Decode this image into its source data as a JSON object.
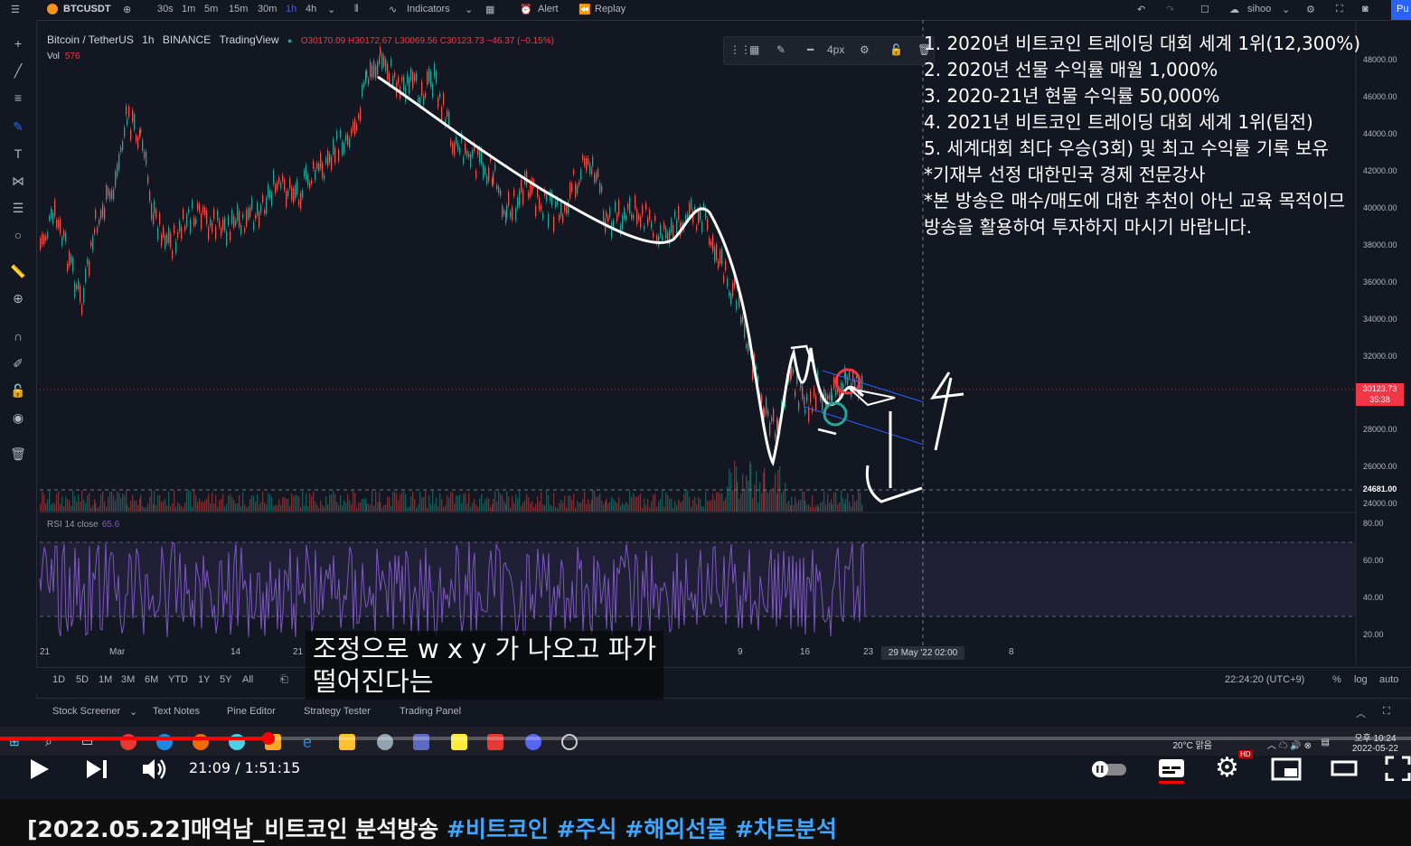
{
  "toolbar": {
    "symbol": "BTCUSDT",
    "intervals": [
      "30s",
      "1m",
      "5m",
      "15m",
      "30m",
      "1h",
      "4h"
    ],
    "active_interval": "1h",
    "indicators": "Indicators",
    "alert": "Alert",
    "replay": "Replay",
    "user": "sihoo",
    "publish": "Pu"
  },
  "legend": {
    "title": "Bitcoin / TetherUS",
    "interval": "1h",
    "exchange": "BINANCE",
    "source": "TradingView",
    "ohlc": "O30170.09 H30172.67 L30069.56 C30123.73 −46.37 (−0.15%)",
    "vol_label": "Vol",
    "vol_value": "576",
    "rsi_label": "RSI 14 close",
    "rsi_value": "65.6"
  },
  "drawing_toolbar": {
    "width_label": "4px"
  },
  "price_axis": [
    "48000.00",
    "46000.00",
    "44000.00",
    "42000.00",
    "40000.00",
    "38000.00",
    "36000.00",
    "34000.00",
    "32000.00",
    "28000.00",
    "26000.00",
    "24000.00"
  ],
  "price_tag": {
    "price": "30123.73",
    "countdown": "35:38"
  },
  "price_tag2": "24681.00",
  "rsi_axis": [
    "80.00",
    "60.00",
    "40.00",
    "20.00"
  ],
  "time_axis": [
    "21",
    "Mar",
    "14",
    "21",
    "9",
    "16",
    "23",
    "8"
  ],
  "date_label": "29 May '22   02:00",
  "overlay_lines": [
    "1. 2020년 비트코인 트레이딩 대회 세계 1위(12,300%)",
    "2. 2020년 선물 수익률 매월 1,000%",
    "3. 2020-21년 현물 수익률 50,000%",
    "4. 2021년 비트코인 트레이딩 대회 세계 1위(팀전)",
    "5. 세계대회 최다 우승(3회) 및 최고 수익률 기록 보유",
    "*기재부 선정 대한민국 경제 전문강사",
    "*본 방송은 매수/매도에 대한 추천이 아닌 교육 목적이므",
    " 방송을 활용하여 투자하지 마시기 바랍니다."
  ],
  "range_bar": {
    "ranges": [
      "1D",
      "5D",
      "1M",
      "3M",
      "6M",
      "YTD",
      "1Y",
      "5Y",
      "All"
    ],
    "clock": "22:24:20 (UTC+9)",
    "percent": "%",
    "log": "log",
    "auto": "auto"
  },
  "panel_tabs": [
    "Stock Screener",
    "Text Notes",
    "Pine Editor",
    "Strategy Tester",
    "Trading Panel"
  ],
  "subtitle": {
    "line1": "조정으로 w x y 가 나오고 파가",
    "line2": "떨어진다는"
  },
  "taskbar": {
    "weather": "20°C  맑음",
    "clock_time": "오후 10:24",
    "clock_date": "2022-05-22"
  },
  "player": {
    "time": "21:09 / 1:51:15",
    "progress": 0.19,
    "hd": "HD"
  },
  "video_title": {
    "text": "[2022.05.22]매억남_비트코인 분석방송 ",
    "tags": [
      "#비트코인",
      "#주식",
      "#해외선물",
      "#차트분석"
    ]
  }
}
